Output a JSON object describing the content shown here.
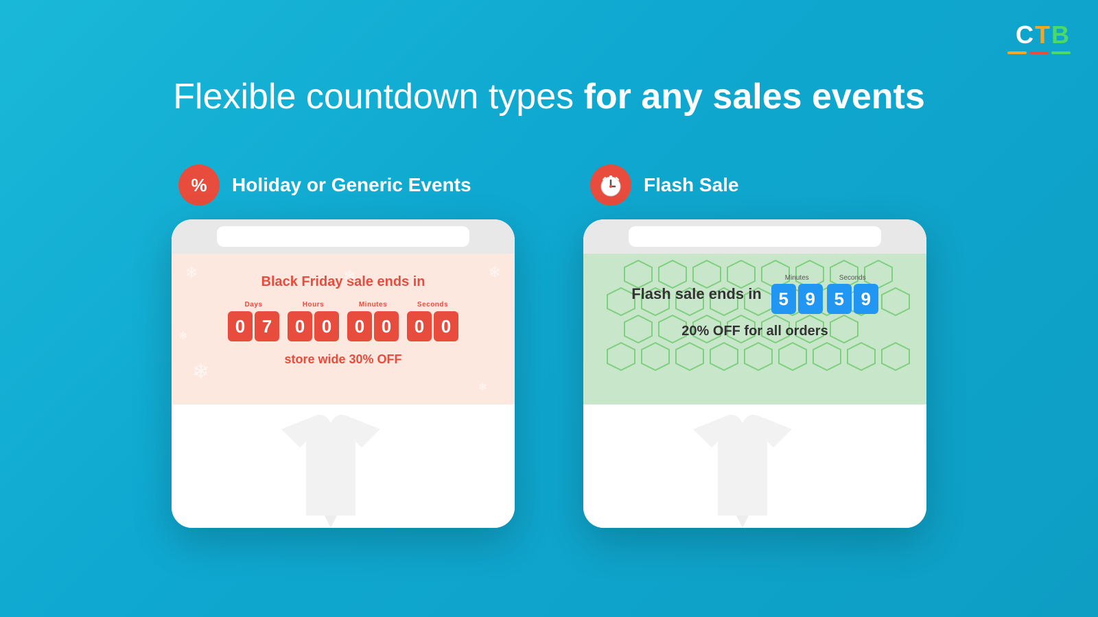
{
  "logo": {
    "text": "CTB",
    "c": "C",
    "t": "T",
    "b": "B"
  },
  "heading": {
    "part1": "Flexible countdown types ",
    "part2": "for any sales events"
  },
  "left_section": {
    "label": "Holiday or Generic Events",
    "icon_type": "percent",
    "timer": {
      "days_label": "Days",
      "hours_label": "Hours",
      "minutes_label": "Minutes",
      "seconds_label": "Seconds",
      "days": [
        "0",
        "7"
      ],
      "hours": [
        "0",
        "0"
      ],
      "minutes": [
        "0",
        "0"
      ],
      "seconds": [
        "0",
        "0"
      ]
    },
    "title": "Black Friday sale ends in",
    "subtitle": "store wide 30% OFF"
  },
  "right_section": {
    "label": "Flash Sale",
    "icon_type": "clock",
    "timer": {
      "minutes_label": "Minutes",
      "seconds_label": "Seconds",
      "minutes": [
        "5",
        "9"
      ],
      "seconds": [
        "5",
        "9"
      ]
    },
    "title": "Flash sale ends in",
    "subtitle": "20% OFF for all orders"
  }
}
